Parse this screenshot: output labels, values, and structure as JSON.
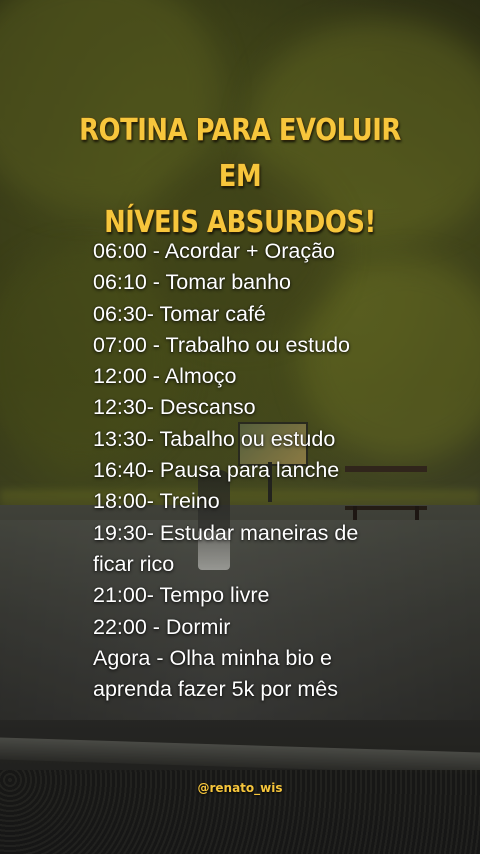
{
  "title": {
    "line1": "ROTINA PARA EVOLUIR EM",
    "line2": "NÍVEIS ABSURDOS!"
  },
  "schedule": [
    "06:00 - Acordar + Oração",
    "06:10 - Tomar banho",
    "06:30- Tomar café",
    "07:00 - Trabalho ou estudo",
    "12:00 - Almoço",
    "12:30- Descanso",
    "13:30- Tabalho ou estudo",
    "16:40- Pausa para lanche",
    "18:00- Treino",
    "19:30- Estudar maneiras de",
    "ficar rico",
    "21:00- Tempo livre",
    "22:00 - Dormir",
    "Agora - Olha minha bio e",
    "aprenda fazer 5k por mês"
  ],
  "handle": "@renato_wis",
  "colors": {
    "title": "#f7c63c",
    "text": "#ffffff",
    "handle": "#f7c63c"
  }
}
